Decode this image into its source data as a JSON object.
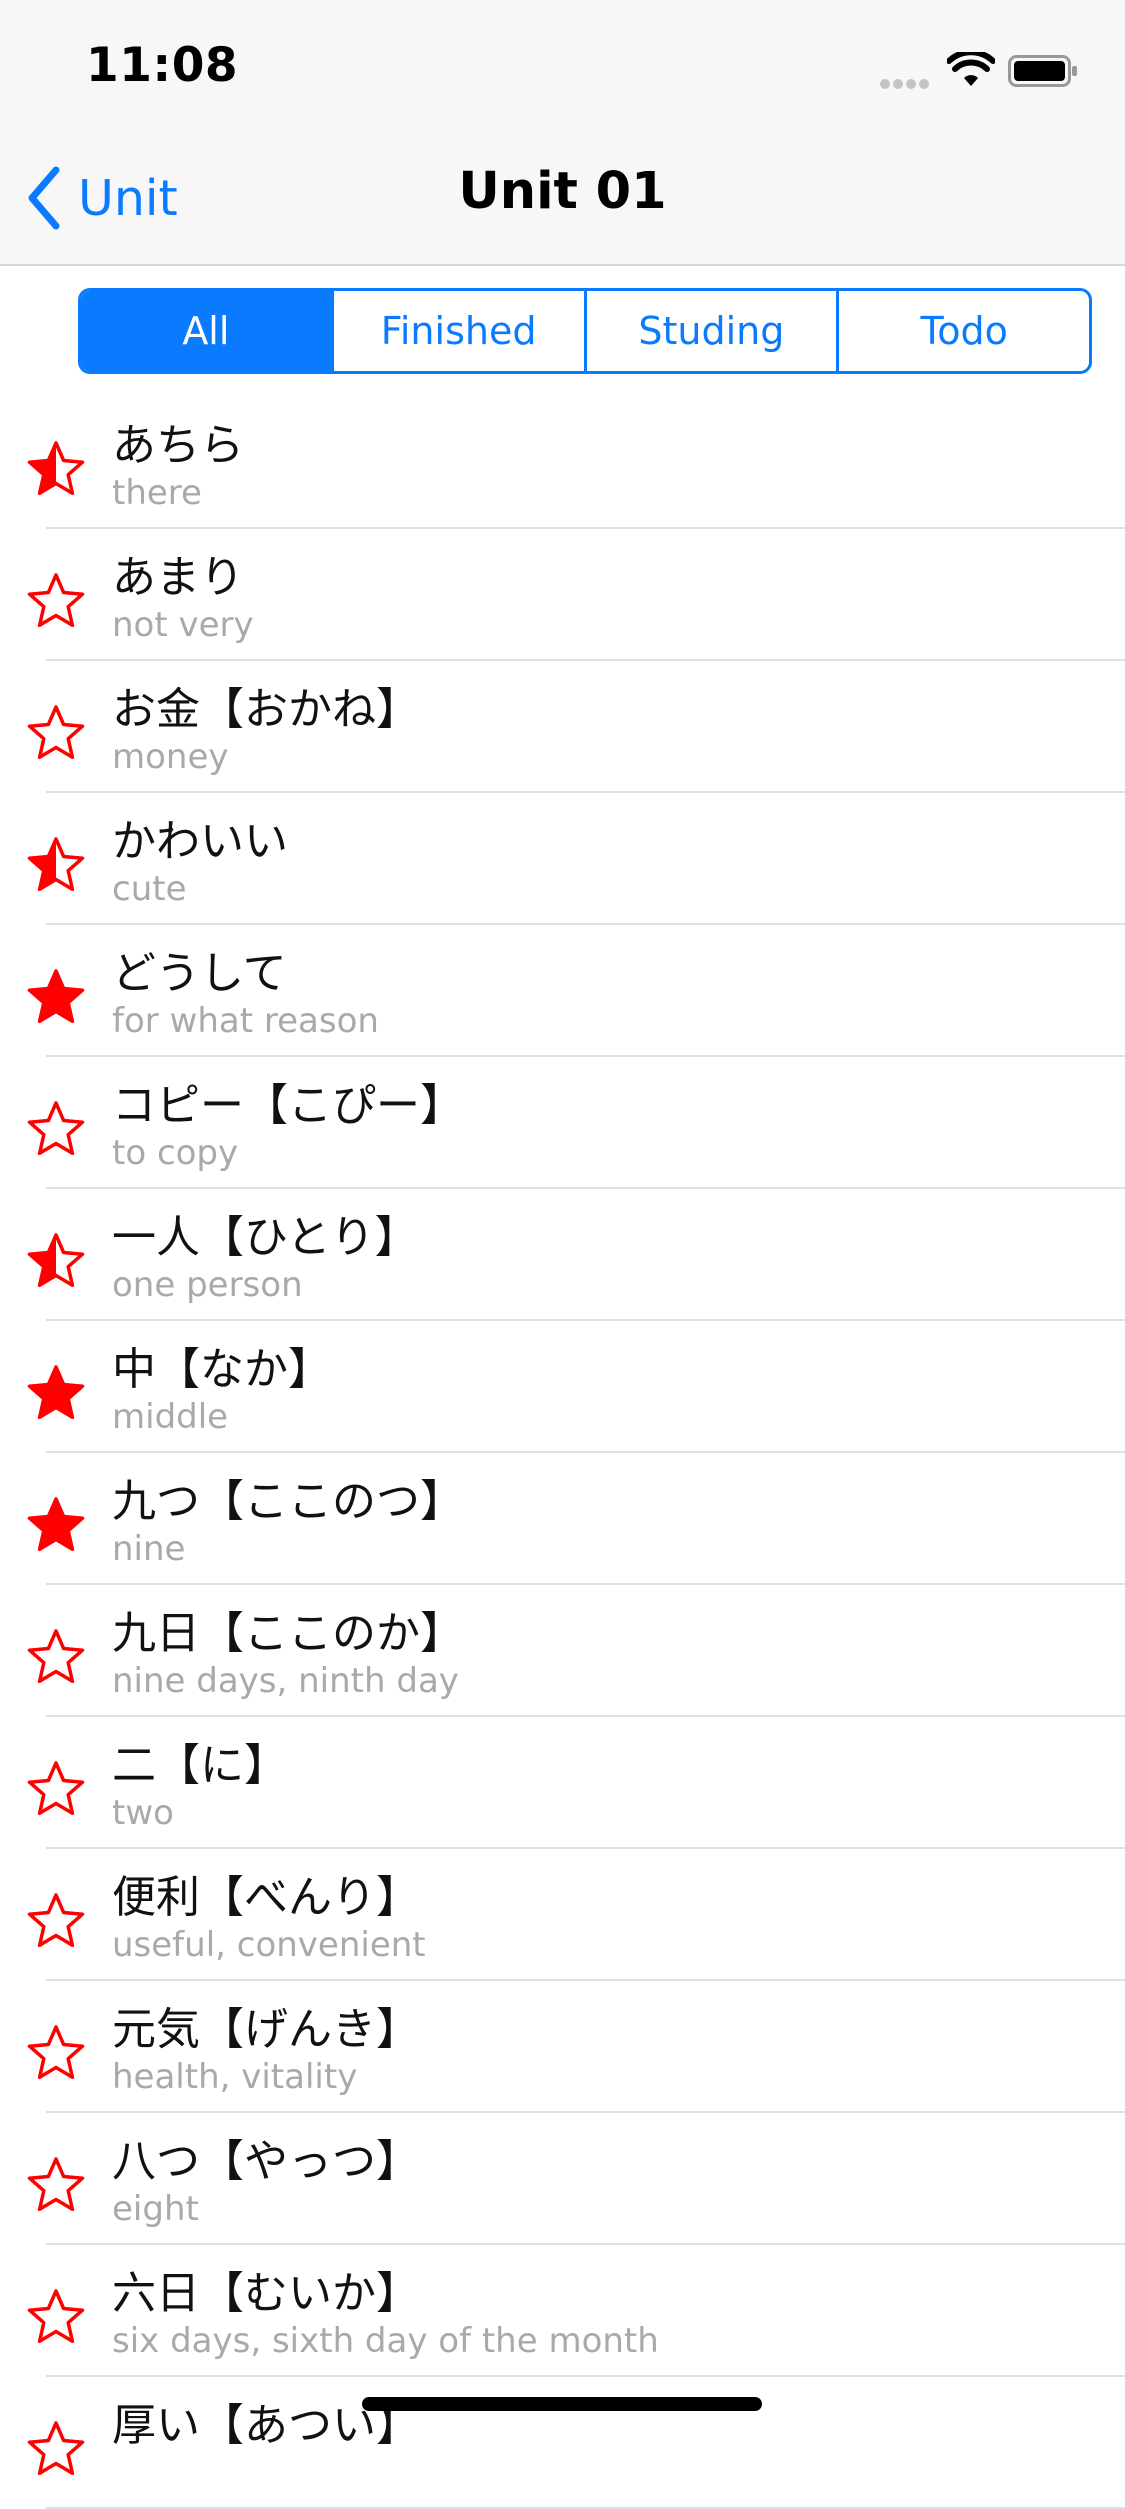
{
  "status_bar": {
    "time": "11:08"
  },
  "nav": {
    "back_label": "Unit",
    "title": "Unit 01"
  },
  "segments": [
    {
      "label": "All",
      "active": true
    },
    {
      "label": "Finished",
      "active": false
    },
    {
      "label": "Studing",
      "active": false
    },
    {
      "label": "Todo",
      "active": false
    }
  ],
  "colors": {
    "accent": "#0a7aff",
    "star": "#ff0000"
  },
  "words": [
    {
      "word": "あちら",
      "meaning": "there",
      "star": "half"
    },
    {
      "word": "あまり",
      "meaning": "not very",
      "star": "empty"
    },
    {
      "word": "お金【おかね】",
      "meaning": "money",
      "star": "empty"
    },
    {
      "word": "かわいい",
      "meaning": "cute",
      "star": "half"
    },
    {
      "word": "どうして",
      "meaning": "for what reason",
      "star": "full"
    },
    {
      "word": "コピー【こぴー】",
      "meaning": "to copy",
      "star": "empty"
    },
    {
      "word": "一人【ひとり】",
      "meaning": "one person",
      "star": "half"
    },
    {
      "word": "中【なか】",
      "meaning": "middle",
      "star": "full"
    },
    {
      "word": "九つ【ここのつ】",
      "meaning": "nine",
      "star": "full"
    },
    {
      "word": "九日【ここのか】",
      "meaning": "nine days, ninth day",
      "star": "empty"
    },
    {
      "word": "二【に】",
      "meaning": "two",
      "star": "empty"
    },
    {
      "word": "便利【べんり】",
      "meaning": "useful, convenient",
      "star": "empty"
    },
    {
      "word": "元気【げんき】",
      "meaning": "health, vitality",
      "star": "empty"
    },
    {
      "word": "八つ【やっつ】",
      "meaning": "eight",
      "star": "empty"
    },
    {
      "word": "六日【むいか】",
      "meaning": "six days, sixth day of the month",
      "star": "empty"
    },
    {
      "word": "厚い【あつい】",
      "meaning": "",
      "star": "empty"
    }
  ]
}
